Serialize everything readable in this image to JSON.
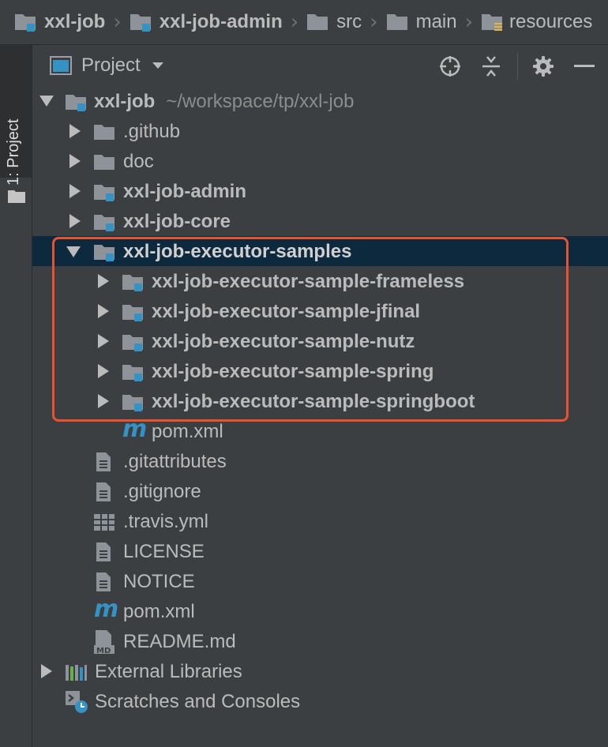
{
  "breadcrumb": [
    {
      "label": "xxl-job",
      "icon": "module-folder-icon",
      "bold": true
    },
    {
      "label": "xxl-job-admin",
      "icon": "module-folder-icon",
      "bold": true
    },
    {
      "label": "src",
      "icon": "folder-icon",
      "bold": false
    },
    {
      "label": "main",
      "icon": "folder-icon",
      "bold": false
    },
    {
      "label": "resources",
      "icon": "resources-folder-icon",
      "bold": false
    }
  ],
  "side_tab": {
    "label": "1: Project"
  },
  "toolbar": {
    "title": "Project"
  },
  "tree": {
    "root": {
      "label": "xxl-job",
      "path": "~/workspace/tp/xxl-job"
    },
    "github": ".github",
    "doc": "doc",
    "admin": "xxl-job-admin",
    "core": "xxl-job-core",
    "samples": "xxl-job-executor-samples",
    "sample_frameless": "xxl-job-executor-sample-frameless",
    "sample_jfinal": "xxl-job-executor-sample-jfinal",
    "sample_nutz": "xxl-job-executor-sample-nutz",
    "sample_spring": "xxl-job-executor-sample-spring",
    "sample_springboot": "xxl-job-executor-sample-springboot",
    "samples_pom": "pom.xml",
    "gitattributes": ".gitattributes",
    "gitignore": ".gitignore",
    "travis": ".travis.yml",
    "license": "LICENSE",
    "notice": "NOTICE",
    "pom": "pom.xml",
    "readme": "README.md",
    "external_libraries": "External Libraries",
    "scratches": "Scratches and Consoles"
  },
  "colors": {
    "background": "#3c3f41",
    "selection": "#0d293e",
    "highlight_box": "#e8522f",
    "module_badge": "#3592c4"
  }
}
